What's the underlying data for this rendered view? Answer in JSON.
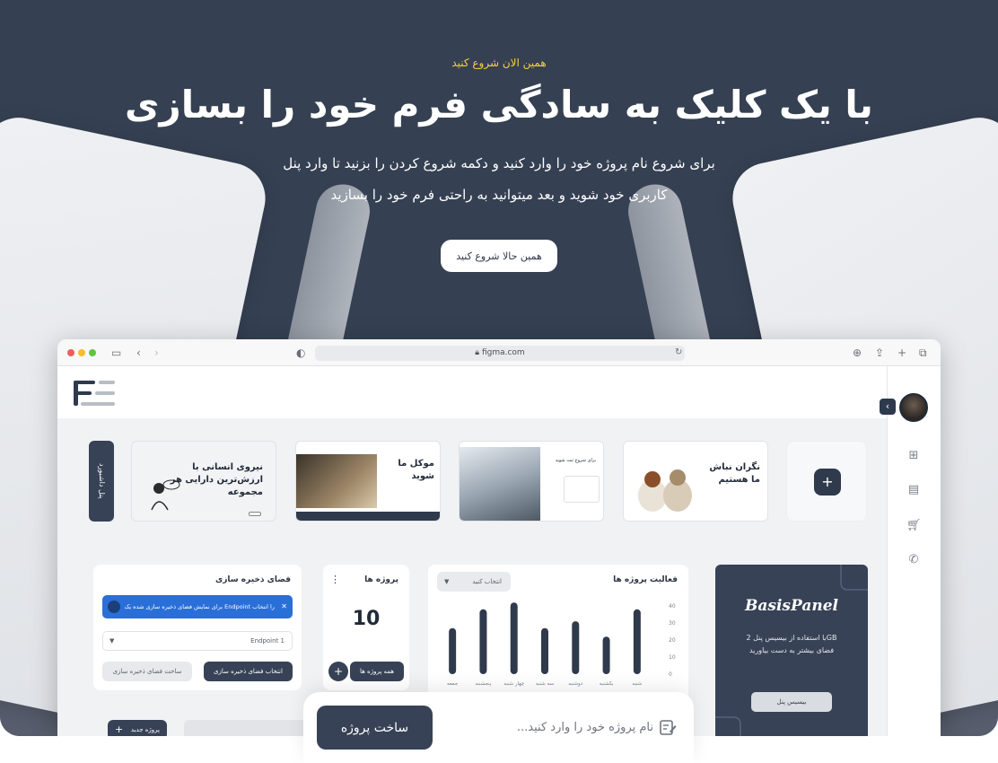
{
  "hero": {
    "kicker": "همین الان شروع کنید",
    "title": "با یک کلیک به سادگی فرم خود را بسازی",
    "subtitle_line1": "برای شروع نام پروژه خود را وارد کنید و دکمه شروع کردن را بزنید تا وارد پنل",
    "subtitle_line2": "کاربری خود شوید و بعد میتوانید به راحتی فرم خود را بسازید",
    "cta_label": "همین حالا شروع کنید"
  },
  "browser": {
    "url": "figma.com"
  },
  "app": {
    "sidetab_label": "پنل داشبورد",
    "templates": [
      {
        "title": "نیروی انسانی با ارزش‌ترین دارایی هر مجموعه"
      },
      {
        "title": "موکل ما شوید"
      },
      {
        "title": "برای شروع ثبت شوید"
      },
      {
        "title": "نگران نباش ما هستیم"
      }
    ],
    "add_label": "+",
    "storage": {
      "title": "فضای ذخیره سازی",
      "alert": "برای نمایش فضای ذخیره سازی شده یک Endpoint را انتخاب کنید.",
      "select_value": "Endpoint 1",
      "primary_btn": "انتخاب فضای ذخیره سازی",
      "secondary_btn": "ساخت فضای ذخیره سازی"
    },
    "projects": {
      "title": "پروژه ها",
      "count": "10",
      "all_btn": "همه پروژه ها",
      "add_btn": "+"
    },
    "activity": {
      "title": "فعالیت پروژه ها",
      "select_placeholder": "انتخاب کنید"
    },
    "promo": {
      "logo": "BasisPanel",
      "text_line1": "با استفاده از بیسیس پنل 2GB",
      "text_line2": "فضای بیشتر به دست بیاورید",
      "btn": "بیسیس پنل"
    },
    "new_project_btn": "پروژه جدید",
    "new_project_plus": "+"
  },
  "chart_data": {
    "type": "bar",
    "title": "فعالیت پروژه ها",
    "categories": [
      "شنبه",
      "یکشنبه",
      "دوشنبه",
      "سه شنبه",
      "چهار شنبه",
      "پنجشنبه",
      "جمعه"
    ],
    "values": [
      38,
      22,
      31,
      27,
      42,
      38,
      27
    ],
    "ylim": [
      0,
      40
    ],
    "yticks": [
      "0",
      "10",
      "20",
      "30",
      "40"
    ],
    "color": "#2f3a4c"
  },
  "create": {
    "button": "ساخت پروژه",
    "placeholder": "نام پروژه خود را وارد کنید..."
  }
}
